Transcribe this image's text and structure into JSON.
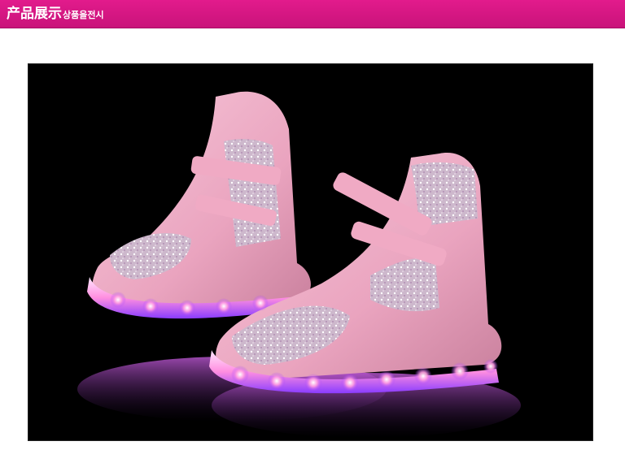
{
  "header": {
    "title": "产品展示",
    "subtitle": "상품을전시",
    "background_color": "#d6167f"
  },
  "product_photo": {
    "background_color": "#000000",
    "shoe_color": "#f2b6cc",
    "glitter_color": "#d9c6d6",
    "led_colors": [
      "#ffffff",
      "#ff7fd6",
      "#b86bff",
      "#6f8bff"
    ]
  }
}
